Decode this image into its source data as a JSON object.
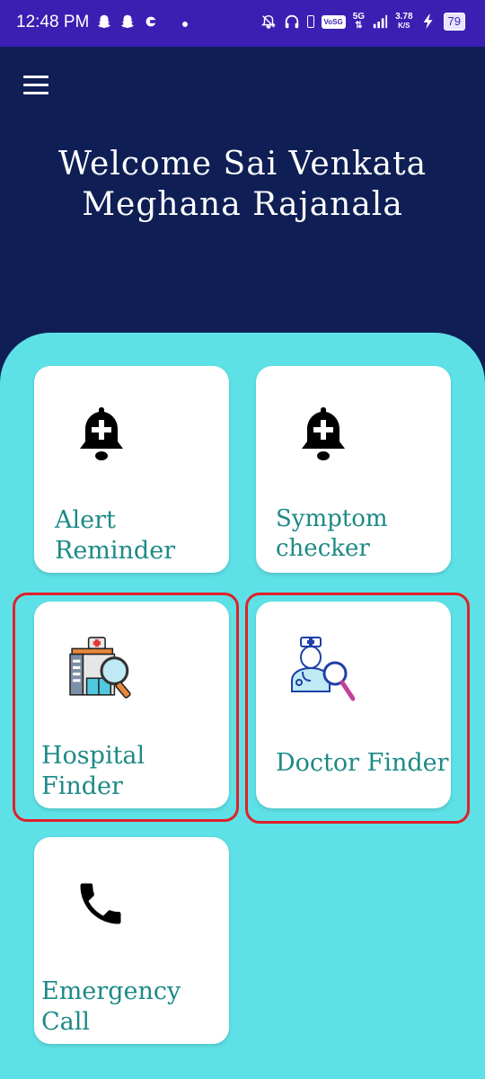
{
  "status_bar": {
    "time": "12:48 PM",
    "network": "5G",
    "speed_value": "3.78",
    "speed_unit": "K/S",
    "battery": "79",
    "volte": "VoSG"
  },
  "header": {
    "menu_icon": "hamburger-menu-icon",
    "welcome_line1": "Welcome Sai Venkata",
    "welcome_line2": "Meghana Rajanala"
  },
  "cards": {
    "alert_reminder": {
      "label_line1": "Alert",
      "label_line2": "Reminder",
      "icon": "bell-plus-icon"
    },
    "symptom_checker": {
      "label_line1": "Symptom",
      "label_line2": "checker",
      "icon": "bell-plus-icon"
    },
    "hospital_finder": {
      "label_line1": "Hospital",
      "label_line2": "Finder",
      "icon": "hospital-search-icon"
    },
    "doctor_finder": {
      "label": "Doctor Finder",
      "icon": "doctor-search-icon"
    },
    "emergency_call": {
      "label_line1": "Emergency",
      "label_line2": "Call",
      "icon": "phone-icon"
    }
  },
  "colors": {
    "status_bar": "#3b1fb2",
    "header_bg": "#0f1f55",
    "panel_bg": "#5ee1e6",
    "label_teal": "#1c8a86",
    "highlight_red": "#e0202a"
  }
}
